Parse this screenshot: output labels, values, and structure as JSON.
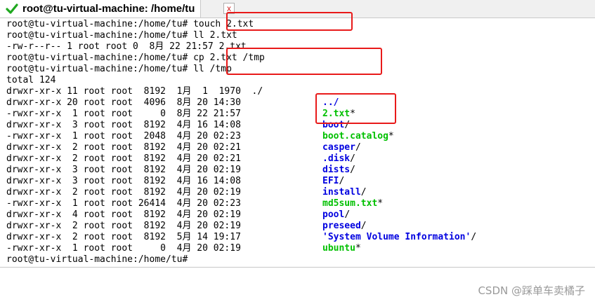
{
  "tab": {
    "title": "root@tu-virtual-machine: /home/tu",
    "close_glyph": "x"
  },
  "colors": {
    "dir": "#0000e0",
    "exec": "#00c000",
    "highlight": "#e81a1a"
  },
  "terminal": {
    "lines": [
      "root@tu-virtual-machine:/home/tu# touch 2.txt",
      "root@tu-virtual-machine:/home/tu# ll 2.txt",
      "-rw-r--r-- 1 root root 0  8月 22 21:57 2.txt",
      "root@tu-virtual-machine:/home/tu# cp 2.txt /tmp",
      "root@tu-virtual-machine:/home/tu# ll /tmp",
      "total 124",
      "drwxr-xr-x 11 root root  8192  1月  1  1970  ./",
      "drwxr-xr-x 20 root root  4096  8月 20 14:30",
      "-rwxr-xr-x  1 root root     0  8月 22 21:57",
      "drwxr-xr-x  3 root root  8192  4月 16 14:08",
      "-rwxr-xr-x  1 root root  2048  4月 20 02:23",
      "drwxr-xr-x  2 root root  8192  4月 20 02:21",
      "drwxr-xr-x  2 root root  8192  4月 20 02:21",
      "drwxr-xr-x  3 root root  8192  4月 20 02:19",
      "drwxr-xr-x  3 root root  8192  4月 16 14:08",
      "drwxr-xr-x  2 root root  8192  4月 20 02:19",
      "-rwxr-xr-x  1 root root 26414  4月 20 02:23",
      "drwxr-xr-x  4 root root  8192  4月 20 02:19",
      "drwxr-xr-x  2 root root  8192  4月 20 02:19",
      "drwxr-xr-x  2 root root  8192  5月 14 19:17",
      "-rwxr-xr-x  1 root root     0  4月 20 02:19",
      "root@tu-virtual-machine:/home/tu#"
    ],
    "files": [
      {
        "name": "../",
        "suffix": "",
        "kind": "dir"
      },
      {
        "name": "2.txt",
        "suffix": "*",
        "kind": "exec"
      },
      {
        "name": "boot",
        "suffix": "/",
        "kind": "dir"
      },
      {
        "name": "boot.catalog",
        "suffix": "*",
        "kind": "exec"
      },
      {
        "name": "casper",
        "suffix": "/",
        "kind": "dir"
      },
      {
        "name": ".disk",
        "suffix": "/",
        "kind": "dir"
      },
      {
        "name": "dists",
        "suffix": "/",
        "kind": "dir"
      },
      {
        "name": "EFI",
        "suffix": "/",
        "kind": "dir"
      },
      {
        "name": "install",
        "suffix": "/",
        "kind": "dir"
      },
      {
        "name": "md5sum.txt",
        "suffix": "*",
        "kind": "exec"
      },
      {
        "name": "pool",
        "suffix": "/",
        "kind": "dir"
      },
      {
        "name": "preseed",
        "suffix": "/",
        "kind": "dir"
      },
      {
        "name": "'System Volume Information'",
        "suffix": "/",
        "kind": "dir"
      },
      {
        "name": "ubuntu",
        "suffix": "*",
        "kind": "exec"
      }
    ]
  },
  "watermark": "CSDN @踩单车卖橘子"
}
